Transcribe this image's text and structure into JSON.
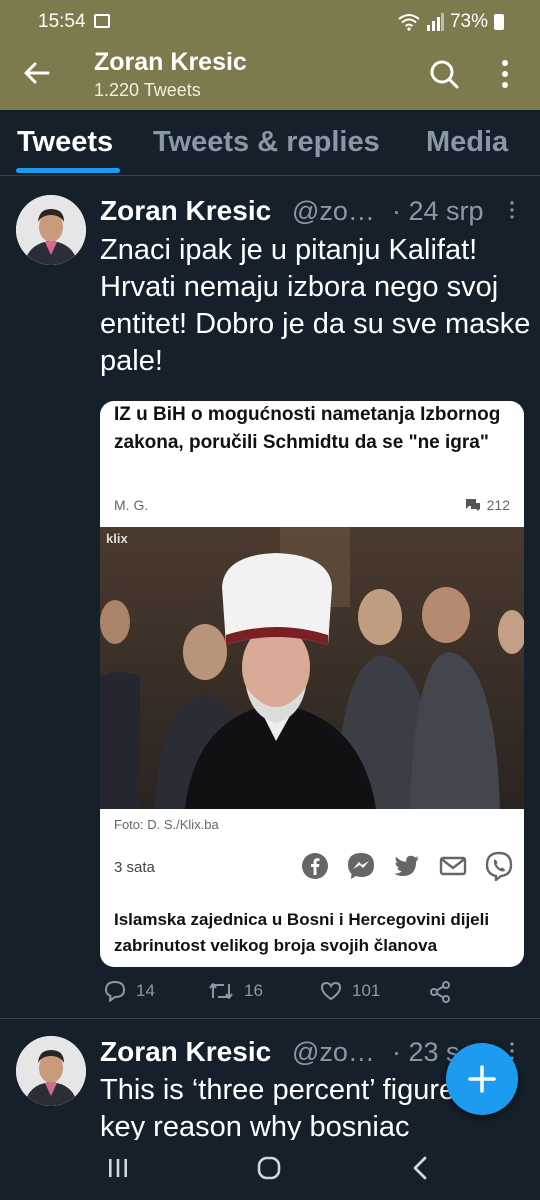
{
  "status": {
    "time": "15:54",
    "battery": "73%"
  },
  "header": {
    "title": "Zoran Kresic",
    "subtitle": "1.220 Tweets"
  },
  "tabs": [
    {
      "label": "Tweets"
    },
    {
      "label": "Tweets & replies"
    },
    {
      "label": "Media"
    }
  ],
  "tweets": [
    {
      "name": "Zoran Kresic",
      "handle": "@zo…",
      "date": "· 24 srp",
      "text": "Znaci ipak je u pitanju Kalifat! Hrvati nemaju izbora nego svoj entitet! Dobro je da su sve maske pale!",
      "card": {
        "title": "IZ u BiH o mogućnosti nametanja Izbornog zakona, poručili Schmidtu da se \"ne igra\"",
        "author": "M. G.",
        "comments": "212",
        "watermark": "klix",
        "caption": "Foto: D. S./Klix.ba",
        "ago": "3 sata",
        "body": "Islamska zajednica u Bosni i Hercegovini dijeli zabrinutost velikog broja svojih članova"
      },
      "replies": "14",
      "retweets": "16",
      "likes": "101"
    },
    {
      "name": "Zoran Kresic",
      "handle": "@zo…",
      "date": "· 23 s",
      "text": "This is ‘three percent’ figure and key reason why bosniac"
    }
  ],
  "colors": {
    "accent": "#1d9bf0",
    "header_bg": "#7d7b4e",
    "background": "#15202b"
  }
}
